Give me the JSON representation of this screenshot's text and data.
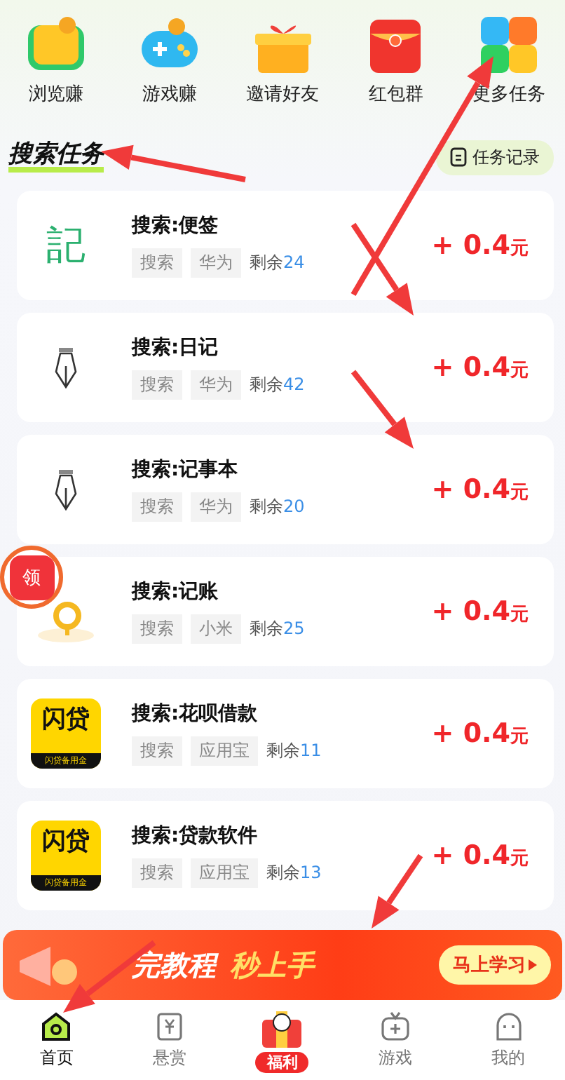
{
  "shortcuts": [
    {
      "label": "浏览赚",
      "kind": "book"
    },
    {
      "label": "游戏赚",
      "kind": "gamepad"
    },
    {
      "label": "邀请好友",
      "kind": "gift"
    },
    {
      "label": "红包群",
      "kind": "envelope"
    },
    {
      "label": "更多任务",
      "kind": "tiles"
    }
  ],
  "section": {
    "title": "搜索任务",
    "record_button": "任务记录"
  },
  "tasks": [
    {
      "kind": "glyph",
      "icon_text": "記",
      "title": "搜索:便签",
      "tags": [
        "搜索",
        "华为"
      ],
      "remaining_label": "剩余",
      "remaining": "24",
      "reward": "+ 0.4",
      "unit": "元"
    },
    {
      "kind": "pen",
      "title": "搜索:日记",
      "tags": [
        "搜索",
        "华为"
      ],
      "remaining_label": "剩余",
      "remaining": "42",
      "reward": "+ 0.4",
      "unit": "元"
    },
    {
      "kind": "pen",
      "title": "搜索:记事本",
      "tags": [
        "搜索",
        "华为"
      ],
      "remaining_label": "剩余",
      "remaining": "20",
      "reward": "+ 0.4",
      "unit": "元"
    },
    {
      "kind": "coin",
      "title": "搜索:记账",
      "tags": [
        "搜索",
        "小米"
      ],
      "remaining_label": "剩余",
      "remaining": "25",
      "reward": "+ 0.4",
      "unit": "元"
    },
    {
      "kind": "logo",
      "icon_text": "闪贷",
      "icon_subtext": "闪贷备用金",
      "title": "搜索:花呗借款",
      "tags": [
        "搜索",
        "应用宝"
      ],
      "remaining_label": "剩余",
      "remaining": "11",
      "reward": "+ 0.4",
      "unit": "元"
    },
    {
      "kind": "logo",
      "icon_text": "闪贷",
      "icon_subtext": "闪贷备用金",
      "title": "搜索:贷款软件",
      "tags": [
        "搜索",
        "应用宝"
      ],
      "remaining_label": "剩余",
      "remaining": "13",
      "reward": "+ 0.4",
      "unit": "元"
    }
  ],
  "floating_badge": {
    "text": "领"
  },
  "banner": {
    "text": "完教程",
    "highlight": "秒上手",
    "button": "马上学习"
  },
  "nav": [
    {
      "label": "首页",
      "kind": "home",
      "selected": true
    },
    {
      "label": "悬赏",
      "kind": "reward",
      "selected": false
    },
    {
      "label": "福利",
      "kind": "gift",
      "selected": false
    },
    {
      "label": "游戏",
      "kind": "game",
      "selected": false
    },
    {
      "label": "我的",
      "kind": "me",
      "selected": false
    }
  ]
}
